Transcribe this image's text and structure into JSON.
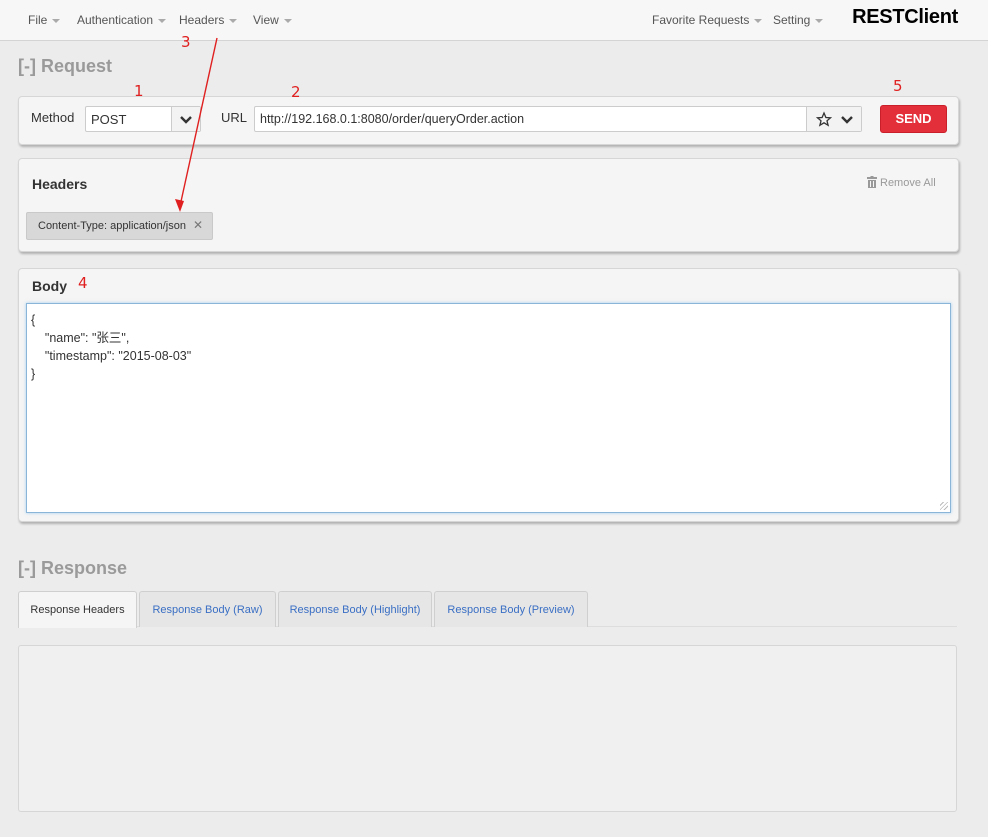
{
  "nav": {
    "left": [
      "File",
      "Authentication",
      "Headers",
      "View"
    ],
    "right": [
      "Favorite Requests",
      "Setting"
    ],
    "brand": "RESTClient"
  },
  "request": {
    "title": "[-] Request",
    "method_label": "Method",
    "method_value": "POST",
    "url_label": "URL",
    "url_value": "http://192.168.0.1:8080/order/queryOrder.action",
    "send_label": "SEND"
  },
  "headers": {
    "title": "Headers",
    "remove_all": "Remove All",
    "items": [
      "Content-Type: application/json"
    ]
  },
  "body": {
    "title": "Body",
    "lines": [
      "{",
      "    \"name\": \"张三\",",
      "    \"timestamp\": \"2015-08-03\"",
      "}"
    ]
  },
  "response": {
    "title": "[-] Response",
    "tabs": [
      "Response Headers",
      "Response Body (Raw)",
      "Response Body (Highlight)",
      "Response Body (Preview)"
    ]
  },
  "annotations": {
    "one": "1",
    "two": "2",
    "three": "3",
    "four": "4",
    "five": "5",
    "color": "#e02020"
  },
  "colors": {
    "send": "#e32f3a",
    "link": "#3a6fc4",
    "section_title": "#9a9a9a"
  }
}
